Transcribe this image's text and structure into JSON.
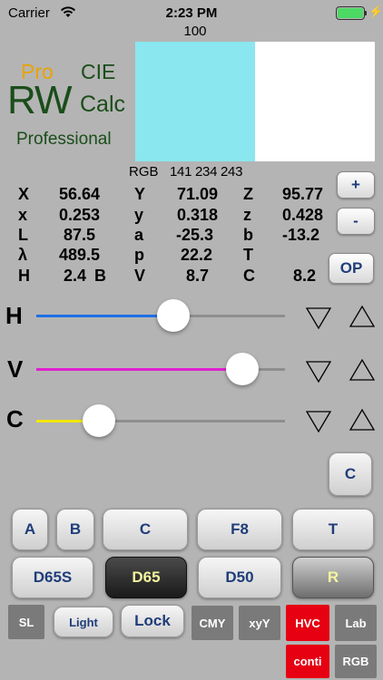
{
  "status": {
    "carrier": "Carrier",
    "time": "2:23 PM"
  },
  "top_value": "100",
  "logo": {
    "pro": "Pro",
    "cie": "CIE",
    "rw": "RW",
    "calc": "Calc",
    "professional": "Professional"
  },
  "swatch": {
    "sample_color": "#8ae6ef",
    "reference_color": "#ffffff"
  },
  "rgb": {
    "label": "RGB",
    "values": "141 234 243"
  },
  "readouts": {
    "X": "56.64",
    "Y": "71.09",
    "Z": "95.77",
    "x": "0.253",
    "y": "0.318",
    "z": "0.428",
    "L": "87.5",
    "a": "-25.3",
    "b": "-13.2",
    "lambda": "489.5",
    "p": "22.2",
    "T": "",
    "H": "2.4",
    "B": "",
    "V": "8.7",
    "C": "8.2"
  },
  "labels": {
    "X": "X",
    "Y": "Y",
    "Z": "Z",
    "x": "x",
    "y": "y",
    "z": "z",
    "L": "L",
    "a": "a",
    "b": "b",
    "lambda": "λ",
    "p": "p",
    "T": "T",
    "H": "H",
    "B": "B",
    "V": "V",
    "C": "C"
  },
  "side_buttons": {
    "plus": "+",
    "minus": "-",
    "op": "OP",
    "c": "C"
  },
  "sliders": [
    {
      "label": "H",
      "color": "#1e6fe6",
      "level": 0.55
    },
    {
      "label": "V",
      "color": "#e020d0",
      "level": 0.83
    },
    {
      "label": "C",
      "color": "#f2e600",
      "level": 0.25
    }
  ],
  "keypad": {
    "row1": [
      "A",
      "B",
      "C",
      "F8",
      "T"
    ],
    "row2": [
      "D65S",
      "D65",
      "D50",
      "R"
    ],
    "row3": [
      "SL",
      "Light",
      "Lock",
      "CMY",
      "xyY",
      "HVC",
      "Lab"
    ],
    "row4": [
      "conti",
      "RGB"
    ]
  }
}
